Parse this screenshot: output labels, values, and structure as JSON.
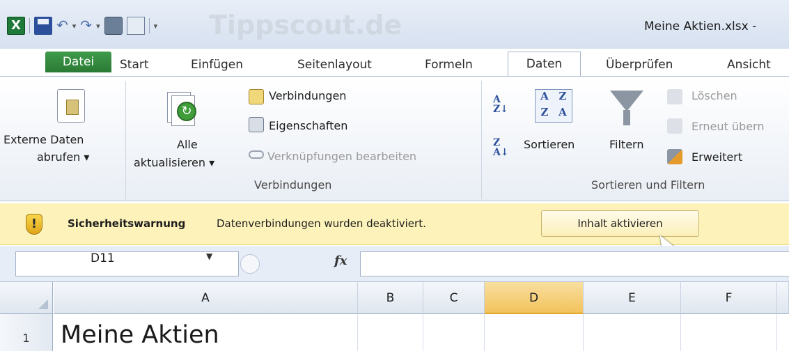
{
  "window": {
    "title": "Meine Aktien.xlsx -",
    "watermark": "Tippscout.de"
  },
  "tabs": [
    "Datei",
    "Start",
    "Einfügen",
    "Seitenlayout",
    "Formeln",
    "Daten",
    "Überprüfen",
    "Ansicht"
  ],
  "ribbon": {
    "externe_daten": {
      "line1": "Externe Daten",
      "line2": "abrufen ▾"
    },
    "alle": {
      "line1": "Alle",
      "line2": "aktualisieren ▾"
    },
    "verbindungen": "Verbindungen",
    "eigenschaften": "Eigenschaften",
    "verknuepfungen": "Verknüpfungen bearbeiten",
    "group_verbindungen": "Verbindungen",
    "sortieren": "Sortieren",
    "filtern": "Filtern",
    "loeschen": "Löschen",
    "erneut": "Erneut übern",
    "erweitert": "Erweitert",
    "group_sort": "Sortieren und Filtern"
  },
  "security": {
    "title": "Sicherheitswarnung",
    "message": "Datenverbindungen wurden deaktiviert.",
    "button": "Inhalt aktivieren"
  },
  "formula_bar": {
    "name_box": "D11",
    "fx": "fx",
    "value": ""
  },
  "grid": {
    "columns": [
      "A",
      "B",
      "C",
      "D",
      "E",
      "F"
    ],
    "selected_column": "D",
    "rows": [
      {
        "number": "1",
        "A": "Meine Aktien"
      }
    ]
  }
}
